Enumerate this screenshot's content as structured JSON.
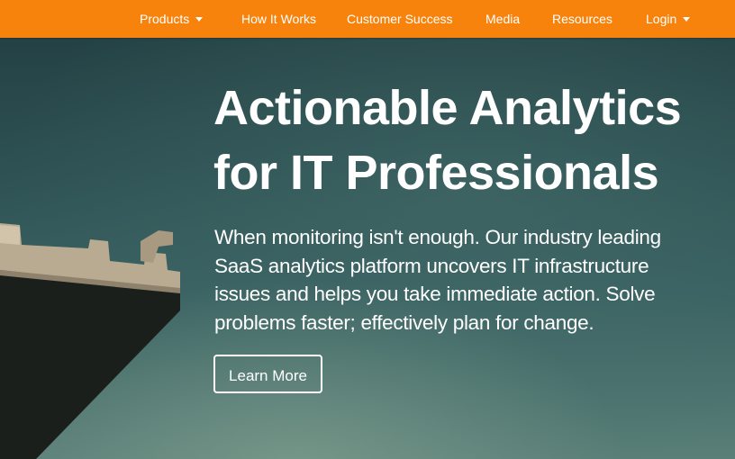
{
  "nav": {
    "products": "Products",
    "how_it_works": "How It Works",
    "customer_success": "Customer Success",
    "media": "Media",
    "resources": "Resources",
    "login": "Login"
  },
  "hero": {
    "headline_line1": "Actionable Analytics",
    "headline_line2": "for IT Professionals",
    "description_lines": [
      "When monitoring isn't enough. Our industry leading",
      "SaaS analytics platform uncovers IT infrastructure",
      "issues and helps you take immediate action. Solve",
      "problems faster; effectively plan for change."
    ],
    "cta_label": "Learn More"
  },
  "colors": {
    "nav_background": "#f7830c",
    "hero_background": "#2d5052",
    "text": "#ffffff"
  }
}
